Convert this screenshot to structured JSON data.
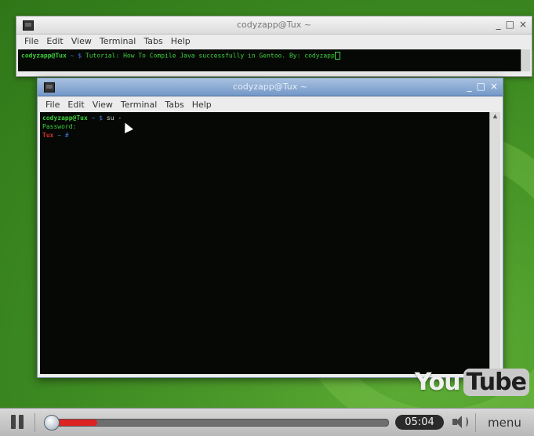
{
  "window_back": {
    "title": "codyzapp@Tux ~",
    "controls": [
      "_",
      "□",
      "×"
    ],
    "menu": [
      "File",
      "Edit",
      "View",
      "Terminal",
      "Tabs",
      "Help"
    ],
    "prompt_user": "codyzapp@Tux",
    "prompt_rest": "~ $",
    "command": "Tutorial: How To Compile Java successfully in Gentoo. By: codyzapp"
  },
  "window_front": {
    "title": "codyzapp@Tux ~",
    "controls": [
      "_",
      "□",
      "×"
    ],
    "menu": [
      "File",
      "Edit",
      "View",
      "Terminal",
      "Tabs",
      "Help"
    ],
    "lines": {
      "l1_user": "codyzapp@Tux",
      "l1_rest": "~ $",
      "l1_cmd": "su -",
      "l2": "Password:",
      "l3_host": "Tux",
      "l3_rest": "~ #"
    }
  },
  "watermark": {
    "you": "You",
    "tube": "Tube"
  },
  "player": {
    "time": "05:04",
    "menu_label": "menu",
    "progress_fraction": 0.15
  },
  "colors": {
    "desktop_green": "#3d8a22",
    "terminal_bg": "#050805",
    "terminal_green": "#3ccf3c",
    "prompt_blue": "#4a78e0",
    "root_red": "#d43030",
    "progress_red": "#dd2222"
  },
  "icons": [
    "terminal-icon",
    "minimize-icon",
    "maximize-icon",
    "close-icon",
    "pause-icon",
    "volume-icon",
    "mouse-pointer-icon"
  ]
}
